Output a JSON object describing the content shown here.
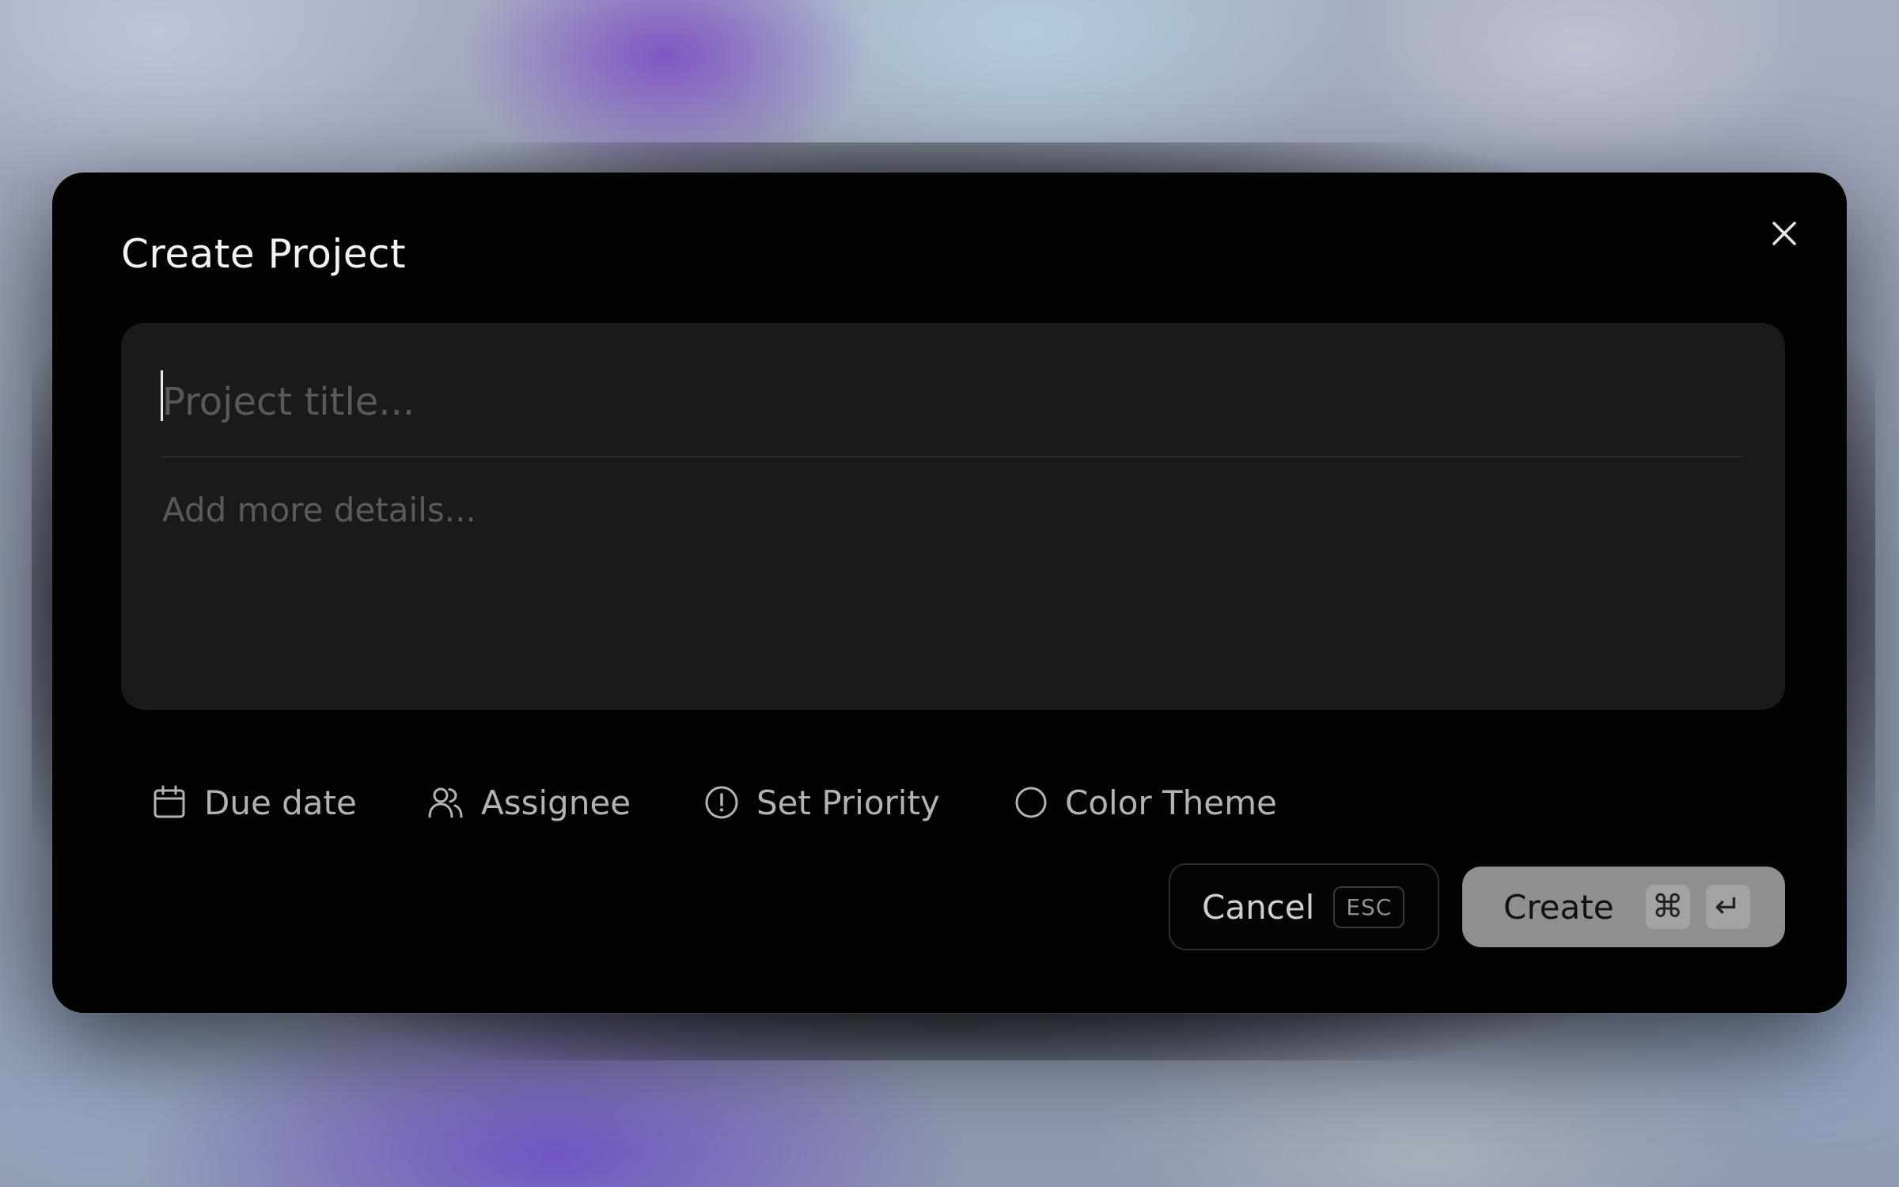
{
  "modal": {
    "title": "Create Project"
  },
  "editor": {
    "title_placeholder": "Project title...",
    "details_placeholder": "Add more details..."
  },
  "options": {
    "due_date": {
      "label": "Due date",
      "icon": "calendar-icon"
    },
    "assignee": {
      "label": "Assignee",
      "icon": "users-icon"
    },
    "priority": {
      "label": "Set Priority",
      "icon": "alert-circle-icon"
    },
    "color_theme": {
      "label": "Color Theme",
      "icon": "circle-icon"
    }
  },
  "actions": {
    "cancel_label": "Cancel",
    "cancel_shortcut": "ESC",
    "create_label": "Create",
    "create_shortcut_mod": "⌘",
    "create_shortcut_key": "↵"
  },
  "colors": {
    "modal_bg": "#020202",
    "editor_bg": "#1a1a1a",
    "create_button_bg": "#8f8f8f",
    "text_primary": "#f2f2f2",
    "text_muted": "#b3b3b3"
  }
}
